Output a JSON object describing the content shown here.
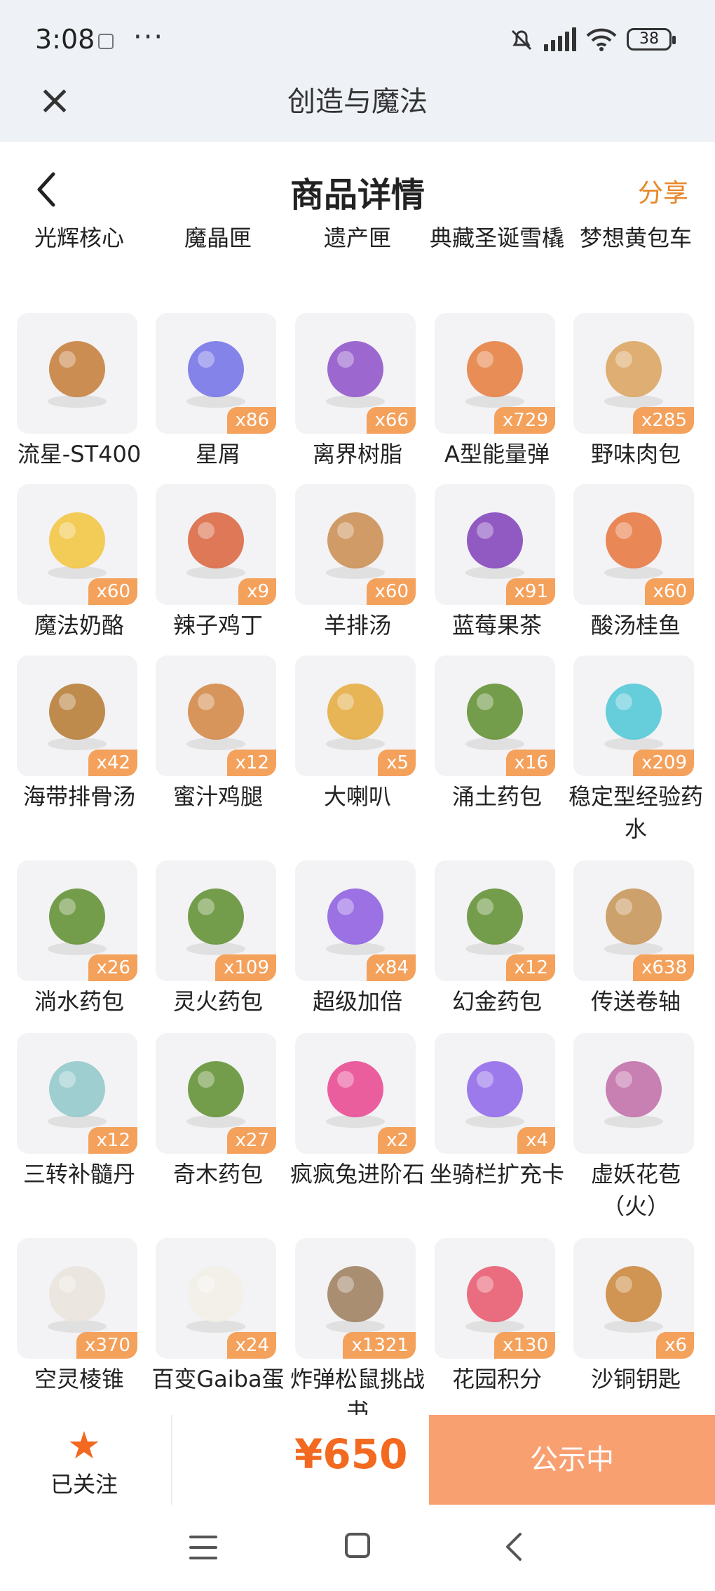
{
  "status_bar": {
    "time": "3:08",
    "battery": "38"
  },
  "app_bar": {
    "title": "创造与魔法"
  },
  "page": {
    "title": "商品详情",
    "share_label": "分享"
  },
  "items": [
    {
      "name": "光辉核心",
      "count": ""
    },
    {
      "name": "魔晶匣",
      "count": ""
    },
    {
      "name": "遗产匣",
      "count": ""
    },
    {
      "name": "典藏圣诞雪橇",
      "count": ""
    },
    {
      "name": "梦想黄包车",
      "count": ""
    },
    {
      "name": "流星-ST400",
      "count": "",
      "icon": "spaceship-icon"
    },
    {
      "name": "星屑",
      "count": "x86",
      "icon": "star-crystal-icon"
    },
    {
      "name": "离界树脂",
      "count": "x66",
      "icon": "resin-icon"
    },
    {
      "name": "A型能量弹",
      "count": "x729",
      "icon": "energy-shell-icon"
    },
    {
      "name": "野味肉包",
      "count": "x285",
      "icon": "bun-basket-icon"
    },
    {
      "name": "魔法奶酪",
      "count": "x60",
      "icon": "cheese-icon"
    },
    {
      "name": "辣子鸡丁",
      "count": "x9",
      "icon": "spicy-chicken-icon"
    },
    {
      "name": "羊排汤",
      "count": "x60",
      "icon": "soup-bowl-icon"
    },
    {
      "name": "蓝莓果茶",
      "count": "x91",
      "icon": "tea-cup-icon"
    },
    {
      "name": "酸汤桂鱼",
      "count": "x60",
      "icon": "fish-dish-icon"
    },
    {
      "name": "海带排骨汤",
      "count": "x42",
      "icon": "stew-bowl-icon"
    },
    {
      "name": "蜜汁鸡腿",
      "count": "x12",
      "icon": "chicken-leg-icon"
    },
    {
      "name": "大喇叭",
      "count": "x5",
      "icon": "megaphone-icon"
    },
    {
      "name": "涌土药包",
      "count": "x16",
      "icon": "potion-bag-icon"
    },
    {
      "name": "稳定型经验药水",
      "count": "x209",
      "icon": "potion-bottle-icon"
    },
    {
      "name": "淌水药包",
      "count": "x26",
      "icon": "potion-bag-icon"
    },
    {
      "name": "灵火药包",
      "count": "x109",
      "icon": "potion-bag-icon"
    },
    {
      "name": "超级加倍",
      "count": "x84",
      "icon": "card-stack-icon"
    },
    {
      "name": "幻金药包",
      "count": "x12",
      "icon": "potion-bag-icon"
    },
    {
      "name": "传送卷轴",
      "count": "x638",
      "icon": "scroll-icon"
    },
    {
      "name": "三转补髓丹",
      "count": "x12",
      "icon": "elixir-bottle-icon"
    },
    {
      "name": "奇木药包",
      "count": "x27",
      "icon": "potion-bag-icon"
    },
    {
      "name": "疯疯兔进阶石",
      "count": "x2",
      "icon": "gem-stone-icon"
    },
    {
      "name": "坐骑栏扩充卡",
      "count": "x4",
      "icon": "crown-card-icon"
    },
    {
      "name": "虚妖花苞（火）",
      "count": "",
      "icon": "flower-bud-icon"
    },
    {
      "name": "空灵棱锥",
      "count": "x370",
      "icon": "pyramid-icon"
    },
    {
      "name": "百变Gaiba蛋",
      "count": "x24",
      "icon": "egg-icon"
    },
    {
      "name": "炸弹松鼠挑战书",
      "count": "x1321",
      "icon": "wanted-poster-icon"
    },
    {
      "name": "花园积分",
      "count": "x130",
      "icon": "flower-token-icon"
    },
    {
      "name": "沙铜钥匙",
      "count": "x6",
      "icon": "key-icon"
    }
  ],
  "bottom_bar": {
    "follow_label": "已关注",
    "price": "¥650",
    "status_label": "公示中"
  }
}
